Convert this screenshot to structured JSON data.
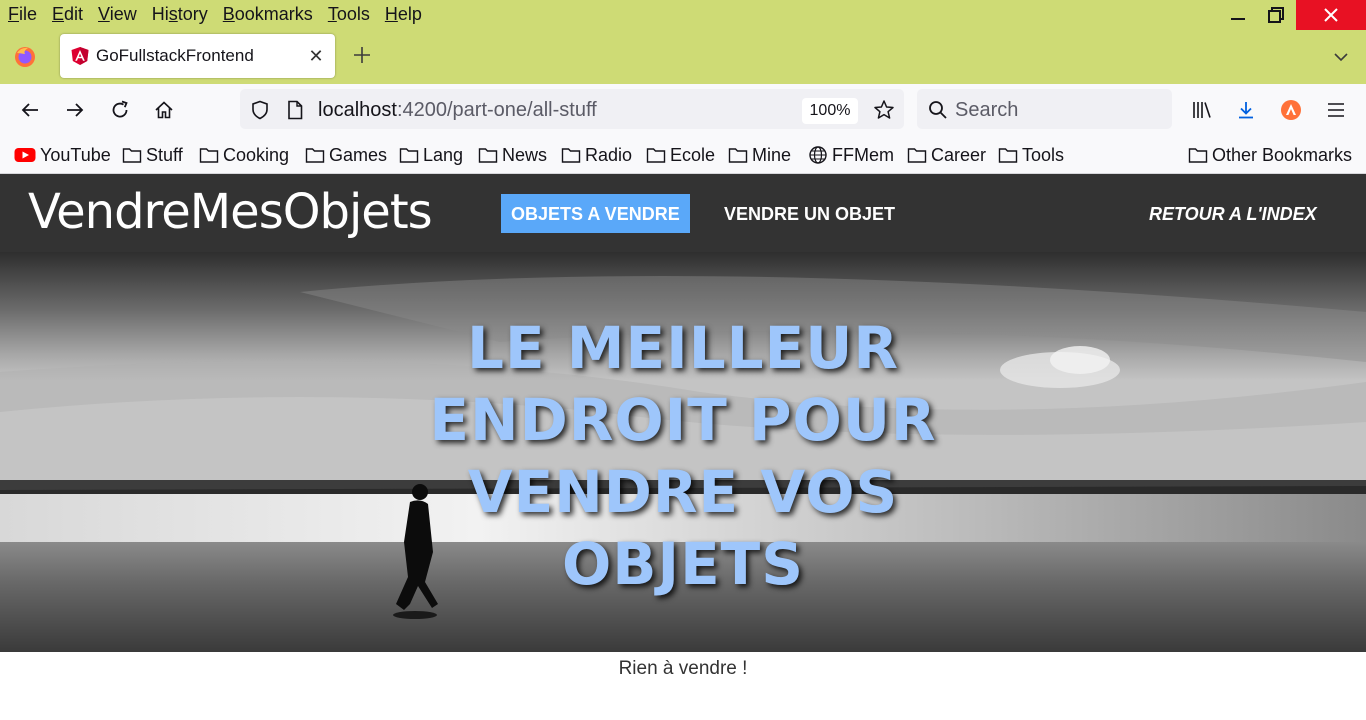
{
  "menubar": {
    "items": [
      {
        "key": "F",
        "rest": "ile"
      },
      {
        "key": "E",
        "rest": "dit"
      },
      {
        "key": "V",
        "rest": "iew"
      },
      {
        "key": "",
        "pre": "Hi",
        "keymid": "s",
        "rest": "tory"
      },
      {
        "key": "B",
        "rest": "ookmarks"
      },
      {
        "key": "T",
        "rest": "ools"
      },
      {
        "key": "H",
        "rest": "elp"
      }
    ]
  },
  "tab": {
    "title": "GoFullstackFrontend",
    "close_symbol": "✕"
  },
  "navbar": {
    "url_host": "localhost",
    "url_path": ":4200/part-one/all-stuff",
    "zoom": "100%",
    "search_placeholder": "Search"
  },
  "bookmarks": {
    "items": [
      "YouTube",
      "Stuff",
      "Cooking",
      "Games",
      "Lang",
      "News",
      "Radio",
      "Ecole",
      "Mine",
      "FFMem",
      "Career",
      "Tools"
    ],
    "other": "Other Bookmarks"
  },
  "site": {
    "brand": "VendreMesObjets",
    "nav": {
      "for_sale": "OBJETS A VENDRE",
      "sell": "VENDRE UN OBJET",
      "back": "RETOUR A L'INDEX"
    },
    "hero_title": "LE MEILLEUR ENDROIT POUR VENDRE VOS OBJETS",
    "empty_message": "Rien à vendre !"
  },
  "colors": {
    "chrome_accent": "#cedb75",
    "nav_active": "#5aa8f9",
    "hero_text": "#9ec6fb",
    "header_bg": "#333333"
  }
}
